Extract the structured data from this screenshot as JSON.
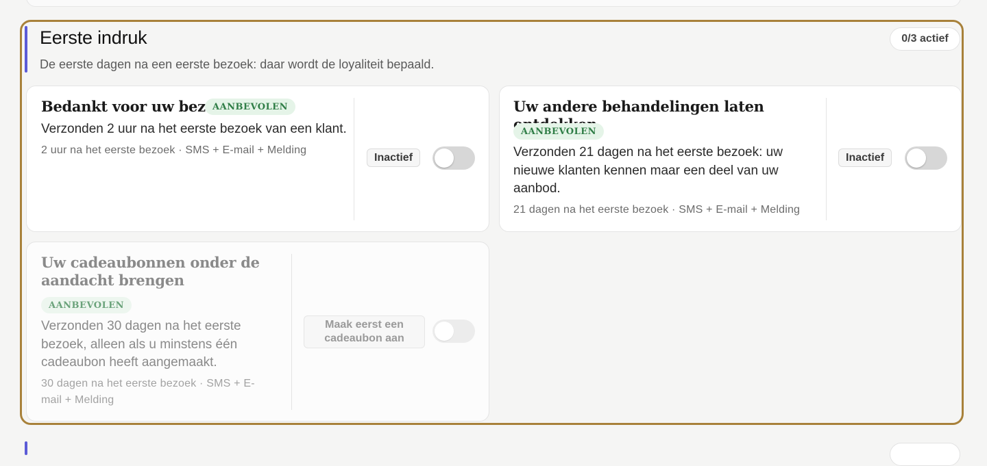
{
  "section": {
    "title": "Eerste indruk",
    "subtitle": "De eerste dagen na een eerste bezoek: daar wordt de loyaliteit bepaald.",
    "active_count": "0/3 actief"
  },
  "cards": [
    {
      "title": "Bedankt voor uw bezoek!",
      "badge": "AANBEVOLEN",
      "description": "Verzonden 2 uur na het eerste bezoek van een klant.",
      "meta": "2 uur na het eerste bezoek · SMS + E-mail + Melding",
      "status": "Inactief",
      "enabled": false
    },
    {
      "title": "Uw andere behandelingen laten ontdekken",
      "badge": "AANBEVOLEN",
      "description": "Verzonden 21 dagen na het eerste bezoek: uw nieuwe klanten kennen maar een deel van uw aanbod.",
      "meta": "21 dagen na het eerste bezoek · SMS + E-mail + Melding",
      "status": "Inactief",
      "enabled": false
    },
    {
      "title": "Uw cadeaubonnen onder de aandacht brengen",
      "badge": "AANBEVOLEN",
      "description": "Verzonden 30 dagen na het eerste bezoek, alleen als u minstens één cadeaubon heeft aangemaakt.",
      "meta": "30 dagen na het eerste bezoek · SMS + E-mail + Melding",
      "status": "Maak eerst een cadeaubon aan",
      "enabled": false,
      "disabled": true
    }
  ],
  "colors": {
    "section_border": "#a8813a",
    "accent": "#5b5bd6",
    "badge_bg": "#e5f4e8",
    "badge_text": "#2f7d46"
  }
}
